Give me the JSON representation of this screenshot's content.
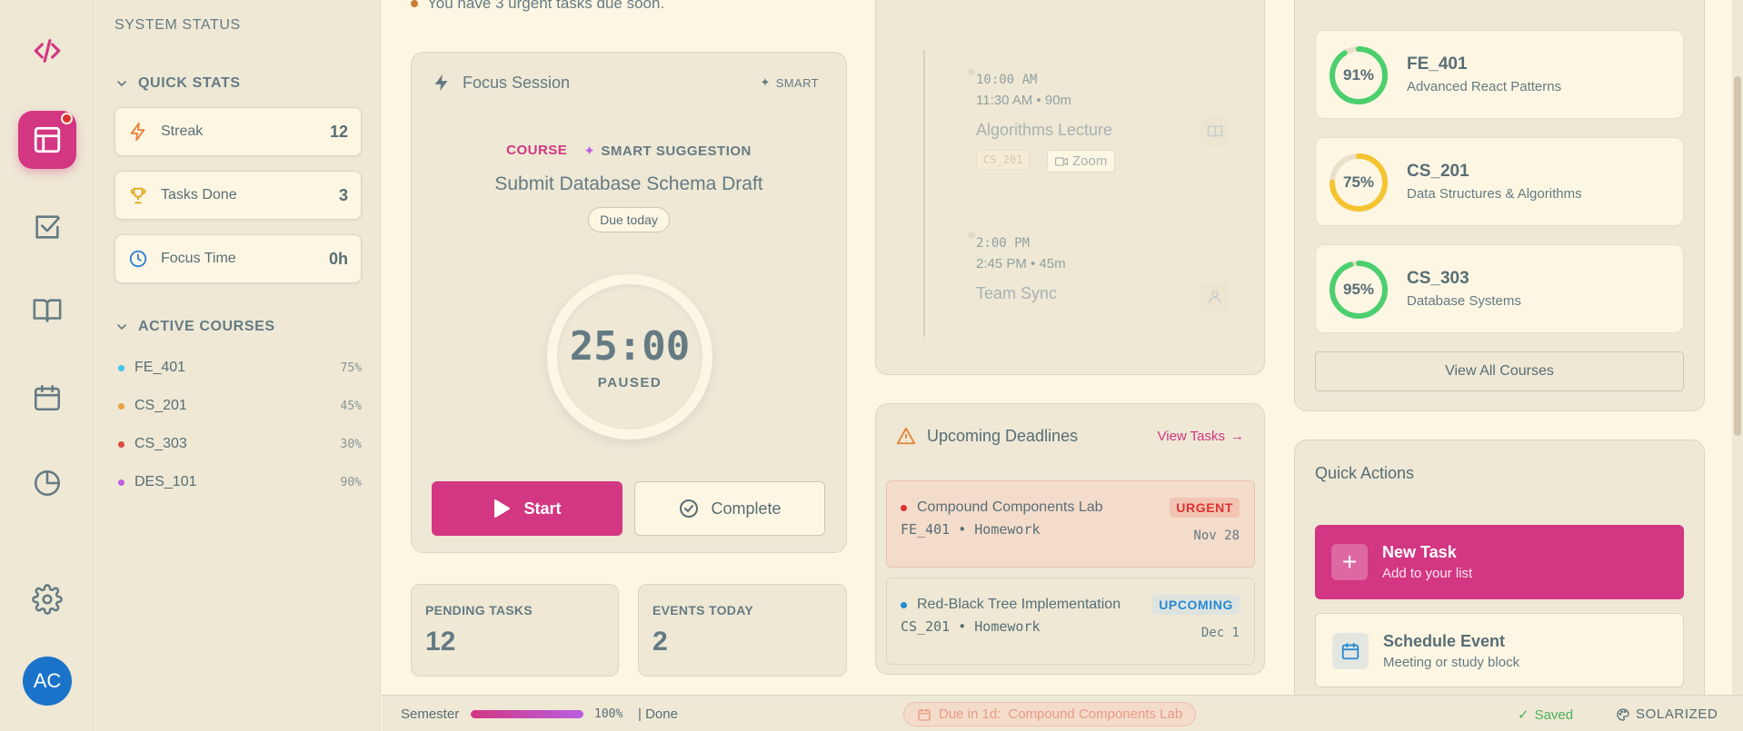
{
  "rail": {
    "avatar_initials": "AC"
  },
  "sidebar": {
    "system_status": "SYSTEM STATUS",
    "quick_stats_heading": "QUICK STATS",
    "stats": [
      {
        "label": "Streak",
        "value": "12"
      },
      {
        "label": "Tasks Done",
        "value": "3"
      },
      {
        "label": "Focus Time",
        "value": "0h"
      }
    ],
    "active_courses_heading": "ACTIVE COURSES",
    "courses": [
      {
        "code": "FE_401",
        "pct": "75%",
        "color": "#3ec5e8"
      },
      {
        "code": "CS_201",
        "pct": "45%",
        "color": "#e8a33e"
      },
      {
        "code": "CS_303",
        "pct": "30%",
        "color": "#dc4a3a"
      },
      {
        "code": "DES_101",
        "pct": "90%",
        "color": "#c060e0"
      }
    ]
  },
  "alert": "You have 3 urgent tasks due soon.",
  "focus": {
    "title": "Focus Session",
    "smart": "SMART",
    "course_label": "COURSE",
    "suggestion_label": "SMART SUGGESTION",
    "task": "Submit Database Schema Draft",
    "due": "Due today",
    "time": "25:00",
    "state": "PAUSED",
    "start": "Start",
    "complete": "Complete"
  },
  "mini": {
    "pending_label": "PENDING TASKS",
    "pending_value": "12",
    "events_label": "EVENTS TODAY",
    "events_value": "2"
  },
  "schedule": [
    {
      "time": "10:00 AM",
      "sub": "11:30 AM • 90m",
      "title": "Algorithms Lecture",
      "code": "CS_201",
      "location": "Zoom"
    },
    {
      "time": "2:00 PM",
      "sub": "2:45 PM • 45m",
      "title": "Team Sync"
    }
  ],
  "deadlines": {
    "title": "Upcoming Deadlines",
    "view_tasks": "View Tasks",
    "items": [
      {
        "name": "Compound Components Lab",
        "meta": "FE_401 • Homework",
        "badge": "URGENT",
        "date": "Nov 28"
      },
      {
        "name": "Red-Black Tree Implementation",
        "meta": "CS_201 • Homework",
        "badge": "UPCOMING",
        "date": "Dec 1"
      }
    ]
  },
  "course_progress": [
    {
      "code": "FE_401",
      "name": "Advanced React Patterns",
      "pct": "91%",
      "value": 0.91,
      "color": "#4ccf6e"
    },
    {
      "code": "CS_201",
      "name": "Data Structures & Algorithms",
      "pct": "75%",
      "value": 0.75,
      "color": "#f4c430"
    },
    {
      "code": "CS_303",
      "name": "Database Systems",
      "pct": "95%",
      "value": 0.95,
      "color": "#4ccf6e"
    }
  ],
  "view_all_courses": "View All Courses",
  "quick_actions": {
    "title": "Quick Actions",
    "new_task": "New Task",
    "new_task_sub": "Add to your list",
    "schedule_event": "Schedule Event",
    "schedule_event_sub": "Meeting or study block"
  },
  "status": {
    "semester": "Semester",
    "semester_progress": 1.0,
    "pct": "100%",
    "done": "| Done",
    "due_prefix": "Due in 1d:",
    "due_task": "Compound Components Lab",
    "saved": "Saved",
    "theme": "SOLARIZED"
  }
}
